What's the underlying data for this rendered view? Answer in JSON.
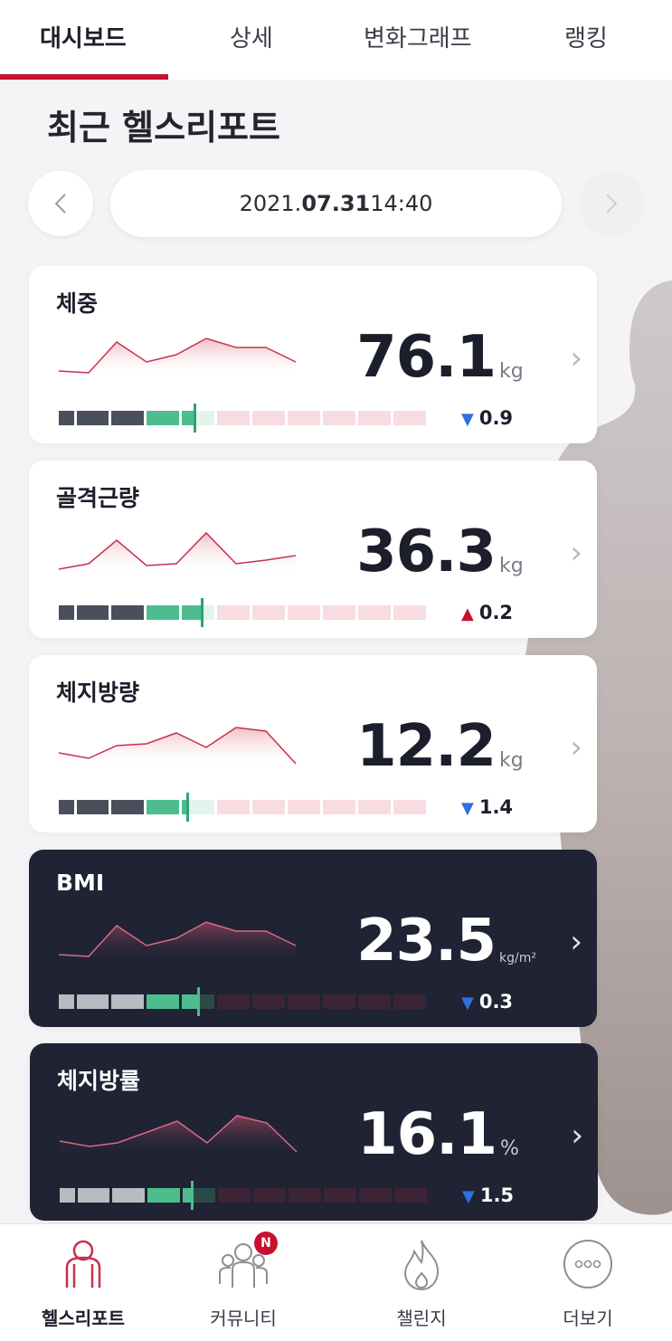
{
  "tabs": [
    {
      "label": "대시보드",
      "active": true
    },
    {
      "label": "상세",
      "active": false
    },
    {
      "label": "변화그래프",
      "active": false
    },
    {
      "label": "랭킹",
      "active": false
    }
  ],
  "section_title": "최근 헬스리포트",
  "date": {
    "year": "2021.",
    "monthday": "07.31",
    "time": " 14:40"
  },
  "nav": {
    "prev_icon": "chevron-left-icon",
    "next_icon": "chevron-right-icon"
  },
  "cards": [
    {
      "title": "체중",
      "value": "76.1",
      "unit": "kg",
      "delta": "0.9",
      "direction": "down",
      "theme": "light",
      "gauge_marker": 0.37
    },
    {
      "title": "골격근량",
      "value": "36.3",
      "unit": "kg",
      "delta": "0.2",
      "direction": "up",
      "theme": "light",
      "gauge_marker": 0.39
    },
    {
      "title": "체지방량",
      "value": "12.2",
      "unit": "kg",
      "delta": "1.4",
      "direction": "down",
      "theme": "light",
      "gauge_marker": 0.35
    },
    {
      "title": "BMI",
      "value": "23.5",
      "unit": "kg/m²",
      "delta": "0.3",
      "direction": "down",
      "theme": "dark",
      "gauge_marker": 0.38
    },
    {
      "title": "체지방률",
      "value": "16.1",
      "unit": "%",
      "delta": "1.5",
      "direction": "down",
      "theme": "dark",
      "gauge_marker": 0.36
    }
  ],
  "bottom_nav": [
    {
      "label": "헬스리포트",
      "icon": "health-report-icon",
      "active": true
    },
    {
      "label": "커뮤니티",
      "icon": "community-icon",
      "active": false,
      "badge": "N"
    },
    {
      "label": "챌린지",
      "icon": "flame-icon",
      "active": false
    },
    {
      "label": "더보기",
      "icon": "more-icon",
      "active": false
    }
  ],
  "colors": {
    "accent": "#c8102e",
    "dark_card": "#1f2333",
    "gauge_dark": "#4a4f5c",
    "gauge_good": "#4dbd8e",
    "gauge_high": "#f7dde1",
    "delta_down": "#2f6fe0",
    "delta_up": "#c8102e"
  }
}
